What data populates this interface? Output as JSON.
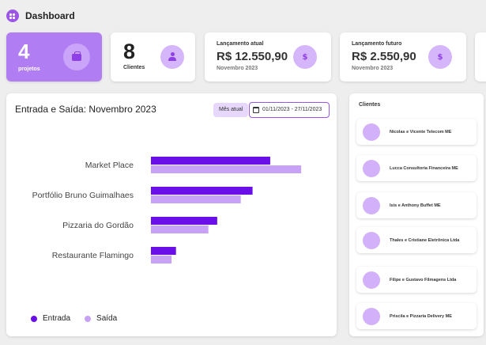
{
  "header": {
    "title": "Dashboard"
  },
  "stats": {
    "projects": {
      "value": "4",
      "label": "projetos"
    },
    "clients": {
      "value": "8",
      "label": "Clientes"
    },
    "current": {
      "label": "Lançamento atual",
      "amount": "R$ 12.550,90",
      "month": "Novembro 2023"
    },
    "future": {
      "label": "Lançamento futuro",
      "amount": "R$ 2.550,90",
      "month": "Novembro 2023"
    }
  },
  "chart_panel": {
    "title": "Entrada e Saída: Novembro 2023",
    "month_button": "Mês atual",
    "date_range": "01/11/2023 - 27/11/2023"
  },
  "chart_data": {
    "type": "bar",
    "orientation": "horizontal",
    "categories": [
      "Market Place",
      "Portfólio Bruno Guimalhaes",
      "Pizzaria do Gordão",
      "Restaurante Flamingo"
    ],
    "series": [
      {
        "name": "Entrada",
        "color": "#6a0fe8",
        "values": [
          81,
          69,
          45,
          17
        ]
      },
      {
        "name": "Saída",
        "color": "#c8a2f7",
        "values": [
          102,
          61,
          39,
          14
        ]
      }
    ],
    "xlim": [
      0,
      110
    ],
    "grid": false,
    "legend_position": "bottom-left"
  },
  "clients_panel": {
    "title": "Clientes",
    "items": [
      "Nicolas e Vicente Telecom ME",
      "Lucca Consultoria Financeira ME",
      "Isis e Anthony Buffet ME",
      "Thales e Cristiane Eletrônica Ltda",
      "Filipe e Gustavo Filmagens Ltda",
      "Priscila e  Pizzaria Delivery ME"
    ]
  },
  "icons": {
    "logo": "dashboard-logo-icon",
    "projects": "briefcase-icon",
    "clients": "person-icon",
    "money": "dollar-icon",
    "calendar": "calendar-icon"
  }
}
